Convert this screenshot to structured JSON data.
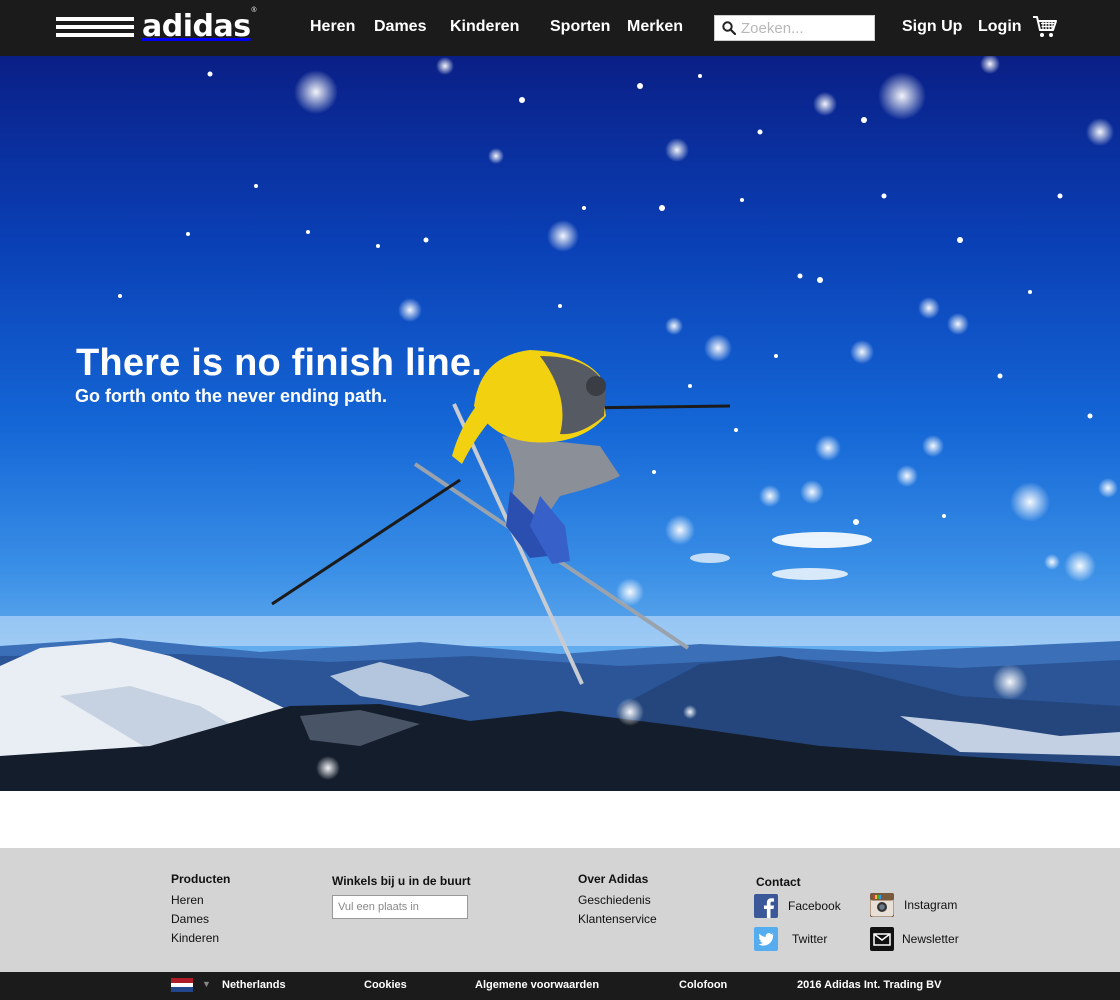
{
  "header": {
    "logo_text": "adidas",
    "nav": [
      "Heren",
      "Dames",
      "Kinderen",
      "Sporten",
      "Merken"
    ],
    "search_placeholder": "Zoeken...",
    "sign_up": "Sign Up",
    "login": "Login",
    "cart_icon": "shopping-cart-icon"
  },
  "hero": {
    "title": "There is no finish line.",
    "subtitle": "Go forth onto the never ending path."
  },
  "footer": {
    "producten": {
      "heading": "Producten",
      "links": [
        "Heren",
        "Dames",
        "Kinderen"
      ]
    },
    "winkels": {
      "heading": "Winkels bij u in de buurt",
      "input_placeholder": "Vul een plaats in"
    },
    "over": {
      "heading": "Over Adidas",
      "links": [
        "Geschiedenis",
        "Klantenservice"
      ]
    },
    "contact": {
      "heading": "Contact",
      "facebook": "Facebook",
      "instagram": "Instagram",
      "twitter": "Twitter",
      "newsletter": "Newsletter"
    }
  },
  "bottombar": {
    "country": "Netherlands",
    "cookies": "Cookies",
    "terms": "Algemene voorwaarden",
    "colofon": "Colofoon",
    "copyright": "2016 Adidas Int. Trading BV"
  },
  "colors": {
    "header_bg": "#1b1b1b",
    "footer_bg": "#d4d4d4",
    "sky_blue": "#1466d6"
  }
}
